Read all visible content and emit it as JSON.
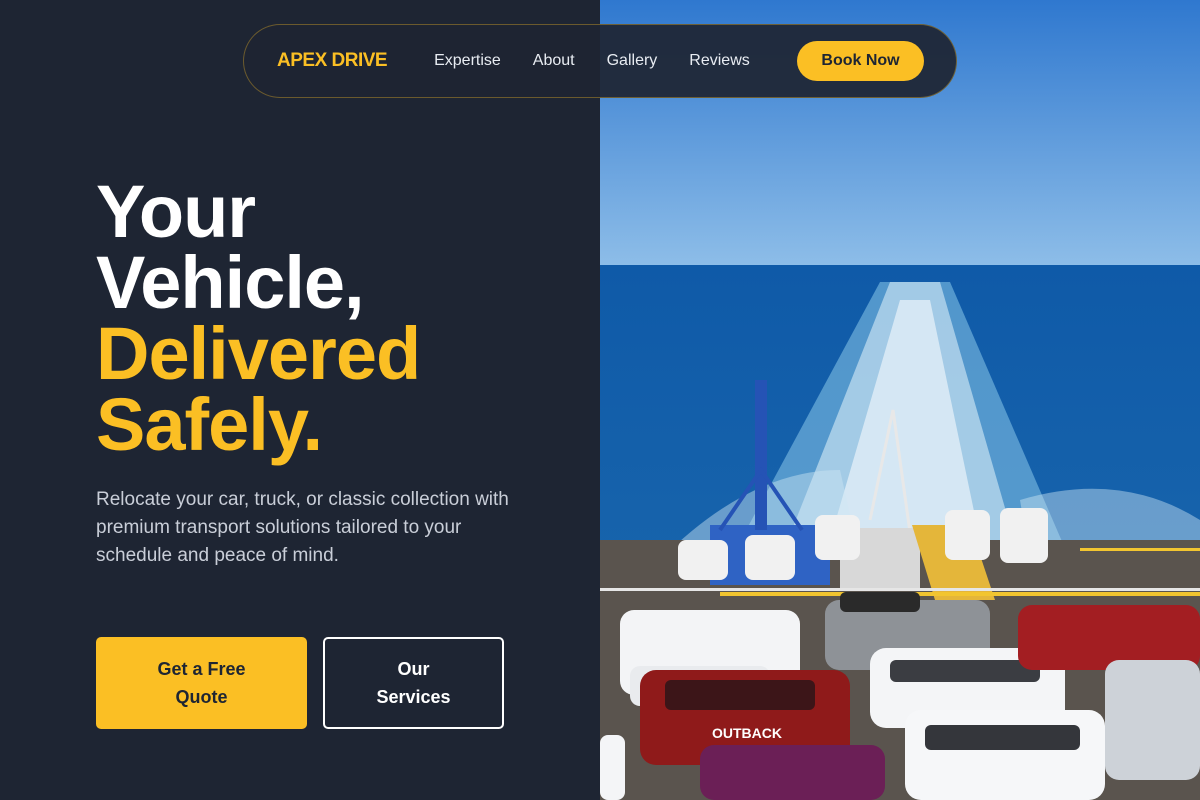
{
  "nav": {
    "brand": "APEX DRIVE",
    "links": [
      "Expertise",
      "About",
      "Gallery",
      "Reviews"
    ],
    "cta": "Book Now"
  },
  "hero": {
    "headline": {
      "line1": "Your",
      "line2": "Vehicle,",
      "line3": "Delivered",
      "line4": "Safely."
    },
    "subtext": "Relocate your car, truck, or classic collection with premium transport solutions tailored to your schedule and peace of mind.",
    "primary_cta": "Get a Free Quote",
    "secondary_cta": "Our Services"
  },
  "image": {
    "description_icon": "ferry-deck-with-cars-photo",
    "van_decal": "OUTBACK"
  },
  "colors": {
    "background": "#1e2533",
    "accent": "#fbbf24",
    "text": "#ffffff",
    "muted_text": "#c9ced8"
  }
}
